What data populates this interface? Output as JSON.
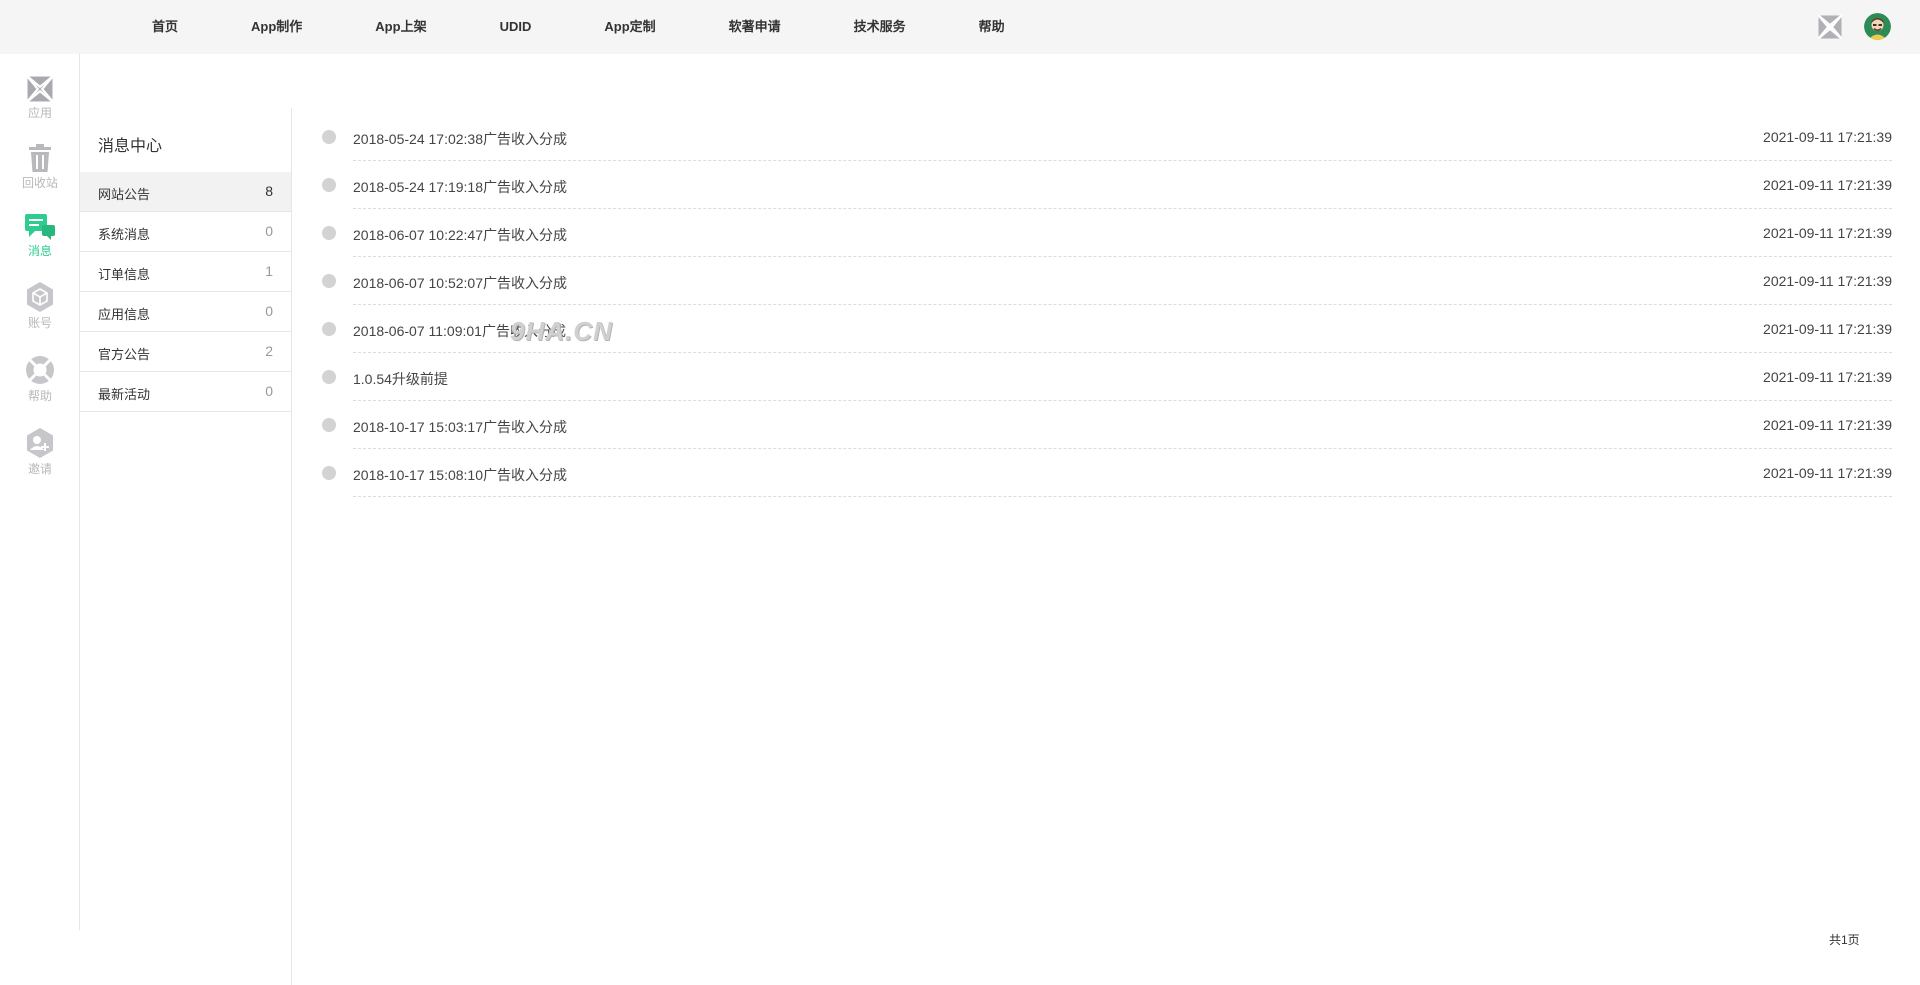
{
  "topnav": {
    "items": [
      "首页",
      "App制作",
      "App上架",
      "UDID",
      "App定制",
      "软著申请",
      "技术服务",
      "帮助"
    ]
  },
  "sidebar": {
    "items": [
      {
        "label": "应用",
        "icon": "apps-grid-icon",
        "active": false
      },
      {
        "label": "回收站",
        "icon": "trash-icon",
        "active": false
      },
      {
        "label": "消息",
        "icon": "message-icon",
        "active": true
      },
      {
        "label": "账号",
        "icon": "account-icon",
        "active": false
      },
      {
        "label": "帮助",
        "icon": "help-lifebuoy-icon",
        "active": false
      },
      {
        "label": "邀请",
        "icon": "invite-icon",
        "active": false
      }
    ]
  },
  "message_center": {
    "title": "消息中心",
    "categories": [
      {
        "name": "网站公告",
        "count": "8",
        "active": true
      },
      {
        "name": "系统消息",
        "count": "0",
        "active": false
      },
      {
        "name": "订单信息",
        "count": "1",
        "active": false
      },
      {
        "name": "应用信息",
        "count": "0",
        "active": false
      },
      {
        "name": "官方公告",
        "count": "2",
        "active": false
      },
      {
        "name": "最新活动",
        "count": "0",
        "active": false
      }
    ]
  },
  "messages": [
    {
      "title": "2018-05-24 17:02:38广告收入分成",
      "time": "2021-09-11 17:21:39"
    },
    {
      "title": "2018-05-24 17:19:18广告收入分成",
      "time": "2021-09-11 17:21:39"
    },
    {
      "title": "2018-06-07 10:22:47广告收入分成",
      "time": "2021-09-11 17:21:39"
    },
    {
      "title": "2018-06-07 10:52:07广告收入分成",
      "time": "2021-09-11 17:21:39"
    },
    {
      "title": "2018-06-07 11:09:01广告收入分成",
      "time": "2021-09-11 17:21:39"
    },
    {
      "title": "1.0.54升级前提",
      "time": "2021-09-11 17:21:39"
    },
    {
      "title": "2018-10-17 15:03:17广告收入分成",
      "time": "2021-09-11 17:21:39"
    },
    {
      "title": "2018-10-17 15:08:10广告收入分成",
      "time": "2021-09-11 17:21:39"
    }
  ],
  "watermark": "9HA.CN",
  "pager": {
    "text": "共1页"
  },
  "colors": {
    "accent": "#2fcc8f",
    "topbar_bg": "#f5f5f6",
    "dot": "#d3d3d3",
    "muted_icon": "#b8b8bd"
  }
}
